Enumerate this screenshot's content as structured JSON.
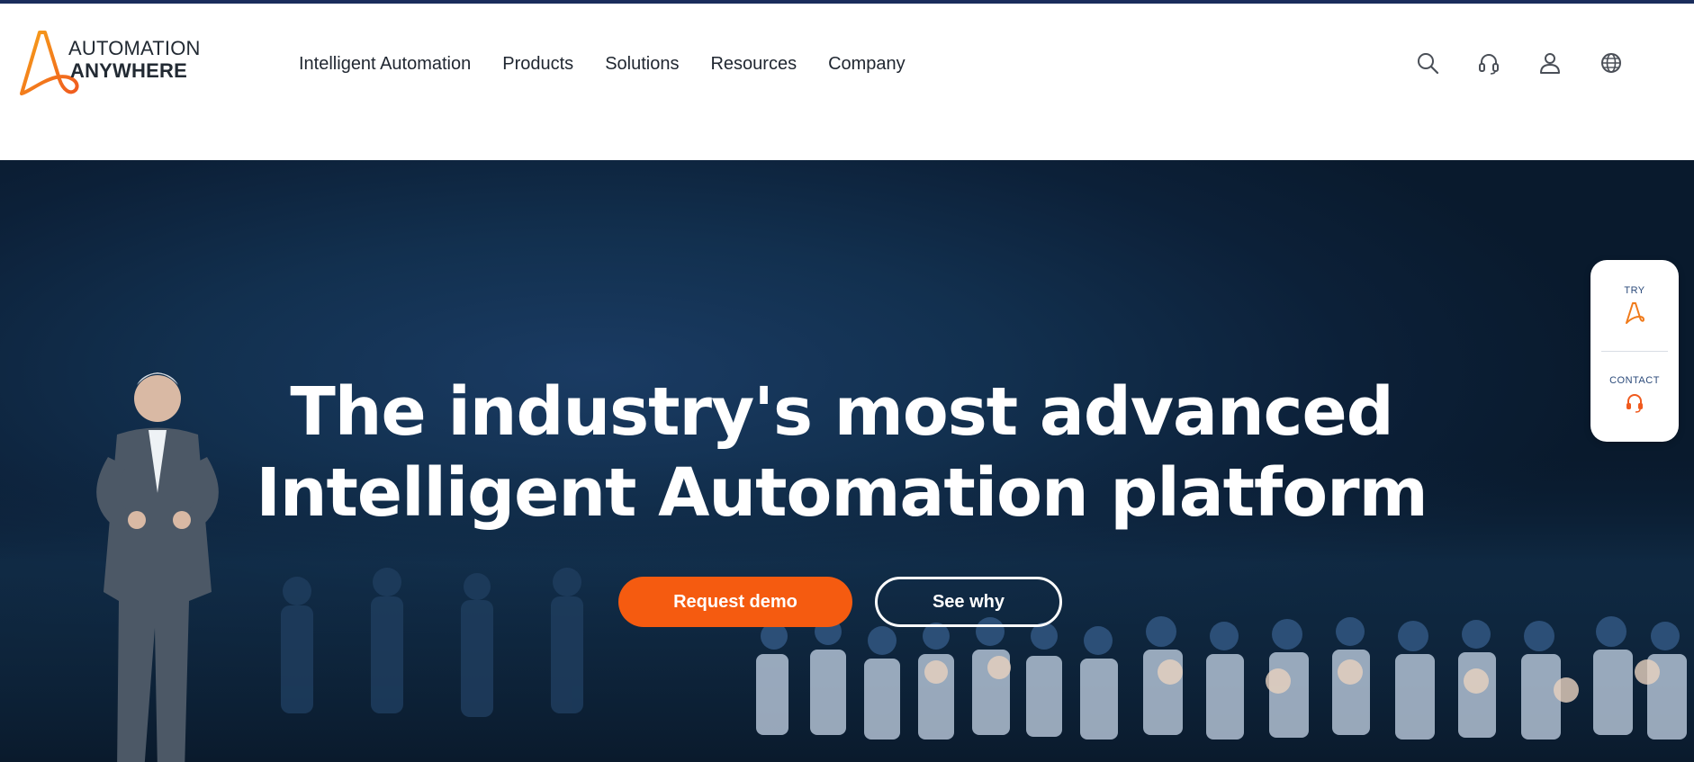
{
  "logo": {
    "line1": "AUTOMATION",
    "line2": "ANYWHERE",
    "icon": "automation-anywhere-a-logo",
    "brand_color": "#f07a1a"
  },
  "nav": {
    "items": [
      {
        "label": "Intelligent Automation"
      },
      {
        "label": "Products"
      },
      {
        "label": "Solutions"
      },
      {
        "label": "Resources"
      },
      {
        "label": "Company"
      }
    ]
  },
  "header_icons": [
    "search-icon",
    "headset-icon",
    "user-icon",
    "globe-icon"
  ],
  "hero": {
    "title_line1": "The industry's most advanced",
    "title_line2": "Intelligent Automation platform",
    "primary_cta": "Request demo",
    "secondary_cta": "See why",
    "accent_color": "#f55b10",
    "background_color": "#0f2a47"
  },
  "side_widget": {
    "try_label": "TRY",
    "contact_label": "CONTACT"
  }
}
